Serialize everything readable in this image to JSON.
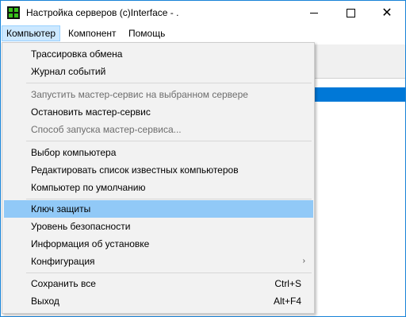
{
  "window": {
    "title": "Настройка серверов (c)Interface - .",
    "close_glyph": "✕"
  },
  "menubar": {
    "items": [
      "Компьютер",
      "Компонент",
      "Помощь"
    ]
  },
  "dropdown": {
    "items": [
      {
        "label": "Трассировка обмена"
      },
      {
        "label": "Журнал событий"
      },
      {
        "label": "Запустить мастер-сервис на выбранном сервере",
        "disabled": true
      },
      {
        "label": "Остановить мастер-сервис"
      },
      {
        "label": "Способ запуска мастер-сервиса...",
        "disabled": true
      },
      {
        "label": "Выбор компьютера"
      },
      {
        "label": "Редактировать список известных компьютеров"
      },
      {
        "label": "Компьютер по умолчанию"
      },
      {
        "label": "Ключ защиты",
        "highlighted": true
      },
      {
        "label": "Уровень безопасности"
      },
      {
        "label": "Информация об установке"
      },
      {
        "label": "Конфигурация",
        "submenu": true,
        "arrow": "›"
      },
      {
        "label": "Сохранить все",
        "shortcut": "Ctrl+S"
      },
      {
        "label": "Выход",
        "shortcut": "Alt+F4"
      }
    ]
  },
  "colors": {
    "accent": "#0078d7",
    "highlight": "#91c9f7",
    "menu_bg": "#f2f2f2",
    "disabled_text": "#6d6d6d"
  }
}
